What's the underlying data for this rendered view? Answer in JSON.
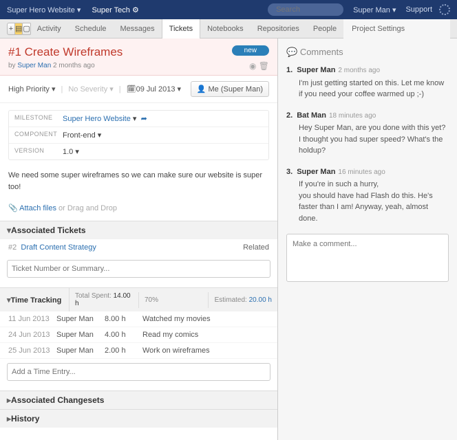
{
  "topbar": {
    "project": "Super Hero Website",
    "team": "Super Tech",
    "search_placeholder": "Search",
    "user": "Super Man",
    "support": "Support"
  },
  "tabs": {
    "activity": "Activity",
    "schedule": "Schedule",
    "messages": "Messages",
    "tickets": "Tickets",
    "notebooks": "Notebooks",
    "repositories": "Repositories",
    "people": "People",
    "settings": "Project Settings"
  },
  "ticket": {
    "number": "#1",
    "title": "Create Wireframes",
    "status": "new",
    "author": "Super Man",
    "age": "2 months ago",
    "priority": "High Priority",
    "severity": "No Severity",
    "date": "09 Jul 2013",
    "assignee": "Me (Super Man)",
    "milestone_label": "MILESTONE",
    "milestone": "Super Hero Website",
    "component_label": "COMPONENT",
    "component": "Front-end",
    "version_label": "VERSION",
    "version": "1.0",
    "description": "We need some super wireframes so we can make sure our website is super too!",
    "attach": "Attach files",
    "attach_hint": "or Drag and Drop"
  },
  "assoc": {
    "heading": "Associated Tickets",
    "num": "#2",
    "title": "Draft Content Strategy",
    "rel": "Related",
    "placeholder": "Ticket Number or Summary..."
  },
  "time": {
    "heading": "Time Tracking",
    "spent_label": "Total Spent:",
    "spent": "14.00 h",
    "pct": "70%",
    "est_label": "Estimated:",
    "est": "20.00 h",
    "rows": [
      {
        "date": "11 Jun 2013",
        "who": "Super Man",
        "h": "8.00 h",
        "note": "Watched my movies"
      },
      {
        "date": "24 Jun 2013",
        "who": "Super Man",
        "h": "4.00 h",
        "note": "Read my comics"
      },
      {
        "date": "25 Jun 2013",
        "who": "Super Man",
        "h": "2.00 h",
        "note": "Work on wireframes"
      }
    ],
    "placeholder": "Add a Time Entry..."
  },
  "sections": {
    "changesets": "Associated Changesets",
    "history": "History"
  },
  "comments": {
    "heading": "Comments",
    "items": [
      {
        "n": "1.",
        "who": "Super Man",
        "when": "2 months ago",
        "body": "I'm just getting started on this. Let me know if you need your coffee warmed up ;-)"
      },
      {
        "n": "2.",
        "who": "Bat Man",
        "when": "18 minutes ago",
        "body": "Hey Super Man, are you done with this yet? I thought you had super speed? What's the holdup?"
      },
      {
        "n": "3.",
        "who": "Super Man",
        "when": "16 minutes ago",
        "body": "If you're in such a hurry,\nyou should have had Flash do this. He's faster than I am! Anyway, yeah, almost done."
      }
    ],
    "placeholder": "Make a comment..."
  }
}
